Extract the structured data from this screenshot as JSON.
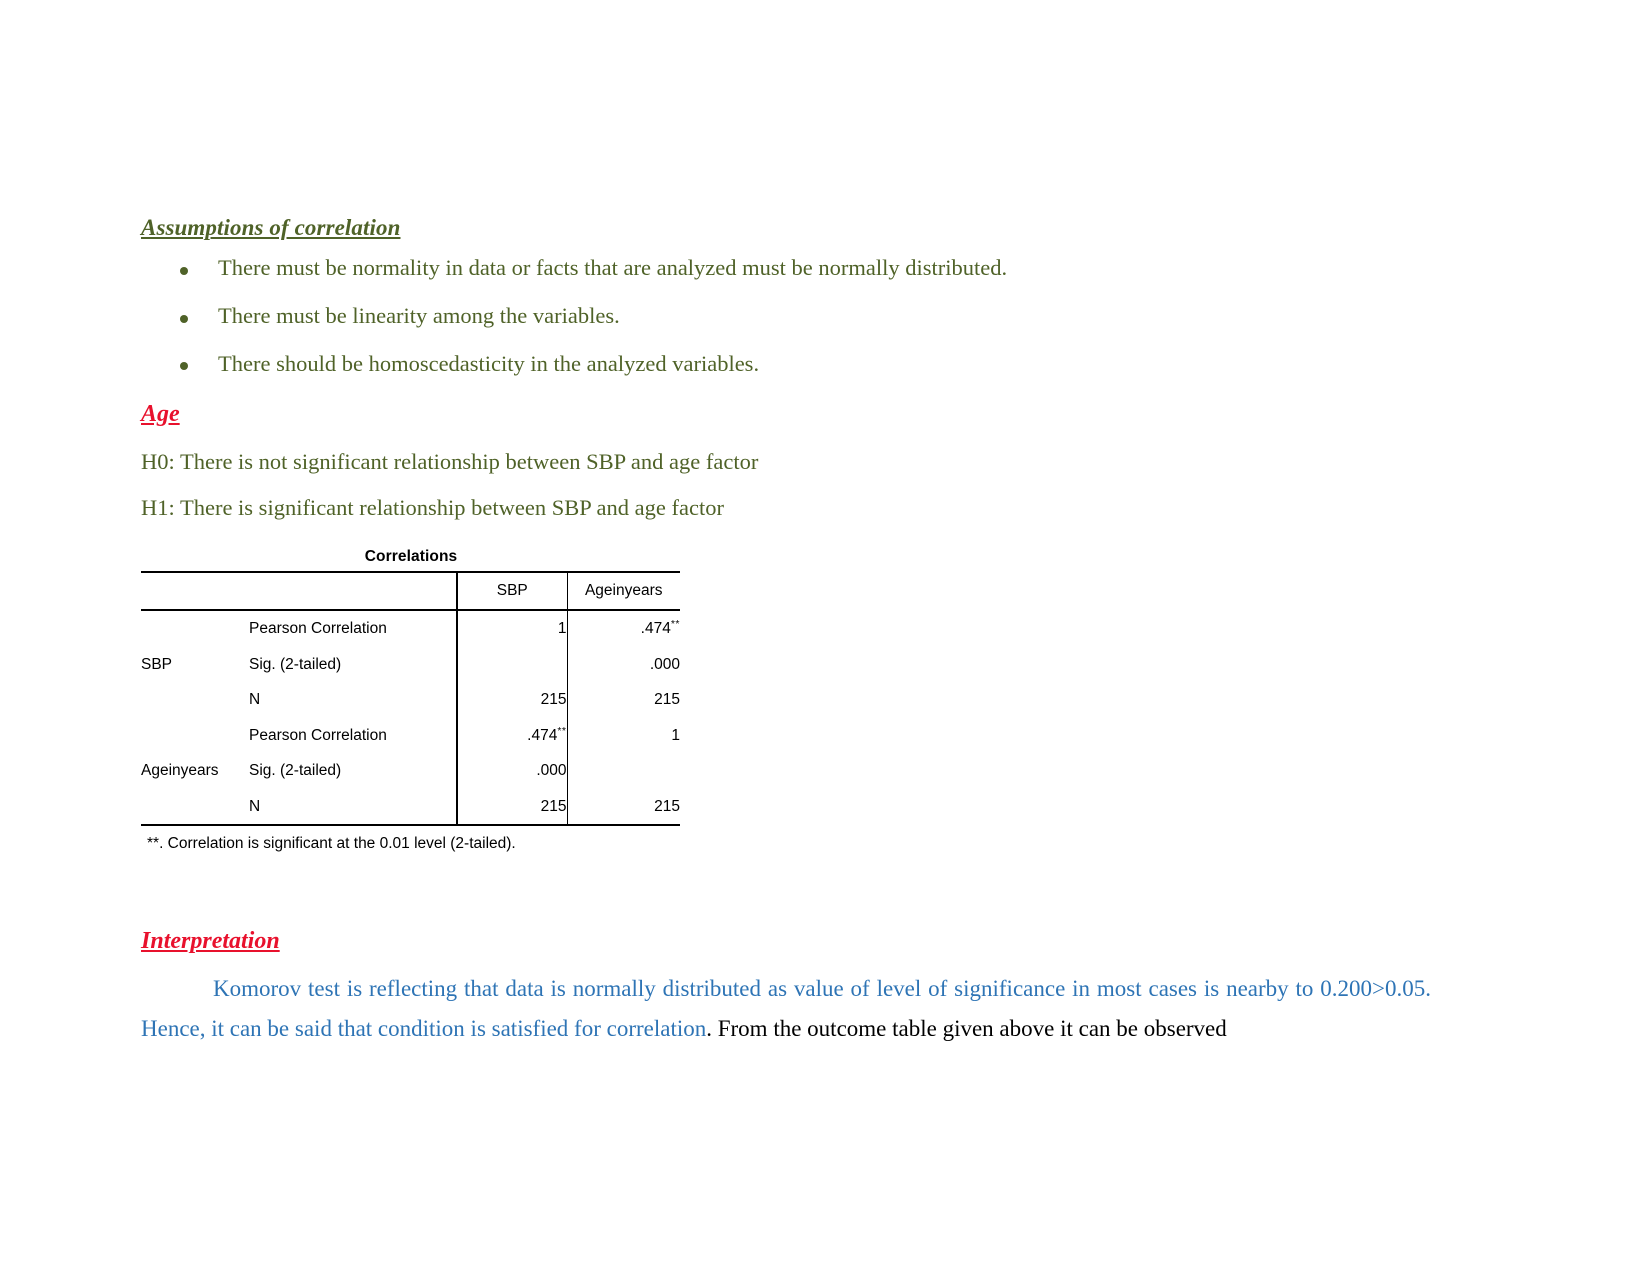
{
  "document": {
    "section_assumptions": {
      "heading": "Assumptions of correlation",
      "bullets": [
        "There must be normality in data or facts that are analyzed must be normally distributed.",
        "There must be linearity among the variables.",
        "There should be homoscedasticity in the analyzed variables."
      ]
    },
    "section_age": {
      "heading": "Age",
      "h0": "H0: There is not significant relationship between SBP and age factor",
      "h1": "H1: There is significant relationship between SBP and age factor"
    },
    "section_interpretation": {
      "heading": "Interpretation ",
      "paragraph_blue": "Komorov test is reflecting that data is normally distributed as value of level of significance in most cases is nearby to 0.200>0.05. Hence, it can be said that condition is satisfied for correlation",
      "paragraph_black": ". From the outcome table given above it can be observed"
    },
    "colors": {
      "green": "#4F6228",
      "red": "#E8112D",
      "blue": "#2E74B5",
      "black": "#000000"
    }
  },
  "spss_table": {
    "title": "Correlations",
    "column_headers": [
      "",
      "",
      "SBP",
      "Ageinyears"
    ],
    "footnote": "**. Correlation is significant at the 0.01 level (2-tailed).",
    "groups": [
      {
        "stub": "SBP",
        "rows": [
          {
            "stat": "Pearson Correlation",
            "sbp": "1",
            "sbp_sup": "",
            "age": ".474",
            "age_sup": "**"
          },
          {
            "stat": "Sig. (2-tailed)",
            "sbp": "",
            "sbp_sup": "",
            "age": ".000",
            "age_sup": ""
          },
          {
            "stat": "N",
            "sbp": "215",
            "sbp_sup": "",
            "age": "215",
            "age_sup": ""
          }
        ]
      },
      {
        "stub": "Ageinyears",
        "rows": [
          {
            "stat": "Pearson Correlation",
            "sbp": ".474",
            "sbp_sup": "**",
            "age": "1",
            "age_sup": ""
          },
          {
            "stat": "Sig. (2-tailed)",
            "sbp": ".000",
            "sbp_sup": "",
            "age": "",
            "age_sup": ""
          },
          {
            "stat": "N",
            "sbp": "215",
            "sbp_sup": "",
            "age": "215",
            "age_sup": ""
          }
        ]
      }
    ]
  }
}
